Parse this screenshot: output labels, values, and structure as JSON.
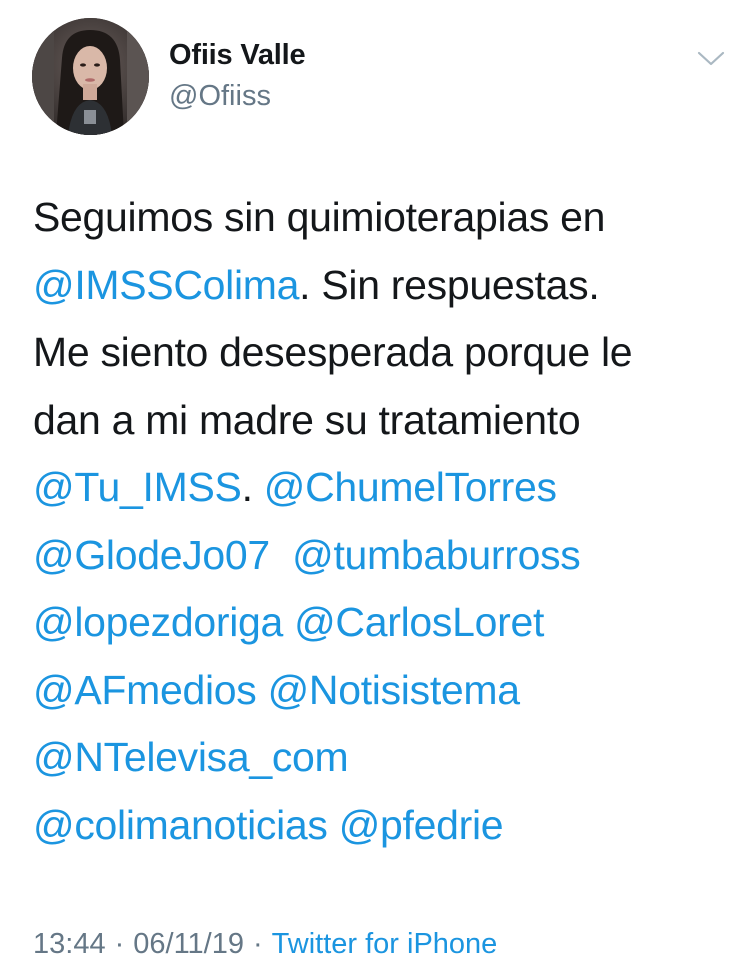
{
  "user": {
    "display_name": "Ofiis Valle",
    "handle": "@Ofiiss"
  },
  "tweet": {
    "lines": [
      [
        {
          "t": "Seguimos sin quimioterapias en",
          "m": false
        }
      ],
      [
        {
          "t": "@IMSSColima",
          "m": true
        },
        {
          "t": ". Sin respuestas.",
          "m": false
        }
      ],
      [
        {
          "t": "Me siento desesperada porque le",
          "m": false
        }
      ],
      [
        {
          "t": "dan a mi madre su tratamiento",
          "m": false
        }
      ],
      [
        {
          "t": "@Tu_IMSS",
          "m": true
        },
        {
          "t": ". ",
          "m": false
        },
        {
          "t": "@ChumelTorres",
          "m": true
        }
      ],
      [
        {
          "t": "@GlodeJo07",
          "m": true
        },
        {
          "t": "  ",
          "m": false
        },
        {
          "t": "@tumbaburross",
          "m": true
        }
      ],
      [
        {
          "t": "@lopezdoriga",
          "m": true
        },
        {
          "t": " ",
          "m": false
        },
        {
          "t": "@CarlosLoret",
          "m": true
        }
      ],
      [
        {
          "t": "@AFmedios",
          "m": true
        },
        {
          "t": " ",
          "m": false
        },
        {
          "t": "@Notisistema",
          "m": true
        }
      ],
      [
        {
          "t": "@NTelevisa_com",
          "m": true
        }
      ],
      [
        {
          "t": "@colimanoticias",
          "m": true
        },
        {
          "t": " ",
          "m": false
        },
        {
          "t": "@pfedrie",
          "m": true
        }
      ]
    ]
  },
  "meta": {
    "time": "13:44",
    "date": "06/11/19",
    "separator": "·",
    "source": "Twitter for iPhone"
  },
  "icons": {
    "caret": "chevron-down-icon",
    "avatar": "avatar"
  },
  "colors": {
    "mention": "#1b95e0",
    "text": "#14171a",
    "secondary": "#657786"
  }
}
